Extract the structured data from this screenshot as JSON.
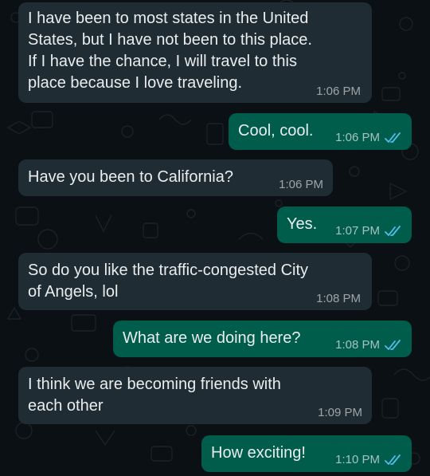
{
  "chat": {
    "messages": [
      {
        "direction": "incoming",
        "text": "I have been to most states in the United\nStates, but I have not been to this place.\nIf I have the chance, I will travel to this\nplace because I love traveling.",
        "time": "1:06 PM"
      },
      {
        "direction": "outgoing",
        "text": "Cool, cool.",
        "time": "1:06 PM",
        "status": "read"
      },
      {
        "direction": "incoming",
        "text": "Have you been to California?",
        "time": "1:06 PM"
      },
      {
        "direction": "outgoing",
        "text": "Yes.",
        "time": "1:07 PM",
        "status": "read"
      },
      {
        "direction": "incoming",
        "text": "So do you like the traffic-congested City\nof Angels, lol",
        "time": "1:08 PM"
      },
      {
        "direction": "outgoing",
        "text": "What are we doing here?",
        "time": "1:08 PM",
        "status": "read"
      },
      {
        "direction": "incoming",
        "text": "I think we are becoming friends with\neach other",
        "time": "1:09 PM"
      },
      {
        "direction": "outgoing",
        "text": "How exciting!",
        "time": "1:10 PM",
        "status": "read"
      }
    ]
  },
  "colors": {
    "background": "#0b1014",
    "incoming_bubble": "#202c33",
    "outgoing_bubble": "#005c4b",
    "read_ticks": "#53bdeb",
    "text": "#e9edef"
  },
  "icons": {
    "read_status": "double-check-icon"
  }
}
